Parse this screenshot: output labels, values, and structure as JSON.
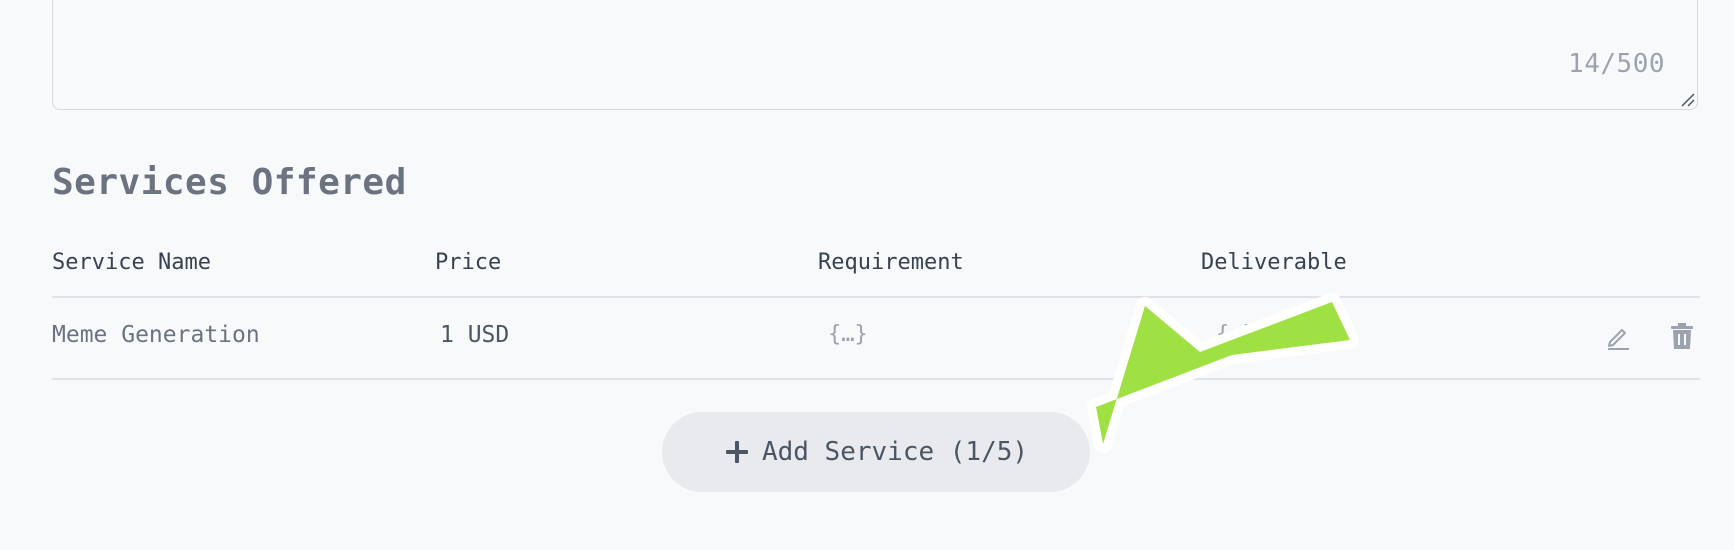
{
  "description_field": {
    "char_count": "14/500"
  },
  "services": {
    "title": "Services Offered",
    "columns": [
      "Service Name",
      "Price",
      "Requirement",
      "Deliverable"
    ],
    "rows": [
      {
        "name": "Meme Generation",
        "price": "1 USD",
        "requirement": "{…}",
        "deliverable": "{…}"
      }
    ],
    "add_button_label": "Add Service (1/5)"
  },
  "icons": {
    "edit": "pencil-icon",
    "delete": "trash-icon",
    "add": "plus-icon"
  },
  "colors": {
    "annotation_arrow": "#9fe142",
    "background": "#f8f9fa",
    "button_bg": "#e9eaed"
  }
}
